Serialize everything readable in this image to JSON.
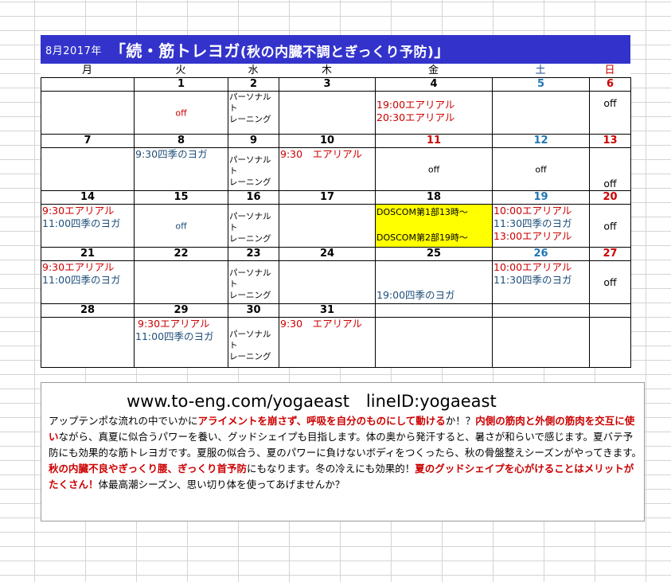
{
  "title": {
    "month": "8月2017年",
    "main_prefix": "「続・筋トレヨガ",
    "main_sub": "(秋の内臓不調とぎっくり予防)",
    "main_suffix": "」"
  },
  "weekdays": [
    "月",
    "火",
    "水",
    "木",
    "金",
    "土",
    "日"
  ],
  "weeks": [
    {
      "nums": [
        "",
        "1",
        "2",
        "3",
        "4",
        "5",
        "6"
      ],
      "cells": [
        {
          "events": []
        },
        {
          "off": "off"
        },
        {
          "personal": [
            "パーソナルト",
            "レーニング"
          ]
        },
        {
          "events": []
        },
        {
          "events": [
            "19:00エアリアル",
            "20:30エアリアル"
          ]
        },
        {
          "events": []
        },
        {
          "off": "off"
        }
      ]
    },
    {
      "nums": [
        "7",
        "8",
        "9",
        "10",
        "11",
        "12",
        "13"
      ],
      "cells": [
        {
          "events": []
        },
        {
          "events": [
            "9:30四季のヨガ"
          ]
        },
        {
          "personal": [
            "パーソナルト",
            "レーニング"
          ]
        },
        {
          "events": [
            "9:30　エアリアル"
          ]
        },
        {
          "off": "off"
        },
        {
          "off": "off"
        },
        {
          "off": "off"
        }
      ]
    },
    {
      "nums": [
        "14",
        "15",
        "16",
        "17",
        "18",
        "19",
        "20"
      ],
      "cells": [
        {
          "events": [
            "9:30エアリアル",
            "11:00四季のヨガ"
          ]
        },
        {
          "off": "off"
        },
        {
          "personal": [
            "パーソナルト",
            "レーニング"
          ]
        },
        {
          "events": []
        },
        {
          "doscom": [
            "DOSCOM第1部13時～",
            "DOSCOM第2部19時～"
          ]
        },
        {
          "events": [
            "10:00エアリアル",
            "11:30四季のヨガ",
            "13:00エアリアル"
          ]
        },
        {
          "off": "off"
        }
      ]
    },
    {
      "nums": [
        "21",
        "22",
        "23",
        "24",
        "25",
        "26",
        "27"
      ],
      "cells": [
        {
          "events": [
            "9:30エアリアル",
            "11:00四季のヨガ"
          ]
        },
        {
          "events": []
        },
        {
          "personal": [
            "パーソナルト",
            "レーニング"
          ]
        },
        {
          "events": []
        },
        {
          "events": [
            "19:00四季のヨガ"
          ]
        },
        {
          "events": [
            "10:00エアリアル",
            "11:30四季のヨガ"
          ]
        },
        {
          "off": "off"
        }
      ]
    },
    {
      "nums": [
        "28",
        "29",
        "30",
        "31",
        "",
        "",
        ""
      ],
      "cells": [
        {
          "events": []
        },
        {
          "events": [
            "9:30エアリアル",
            "11:00四季のヨガ"
          ]
        },
        {
          "personal": [
            "パーソナルト",
            "レーニング"
          ]
        },
        {
          "events": [
            "9:30　エアリアル"
          ]
        },
        {
          "events": []
        },
        {
          "events": []
        },
        {
          "events": []
        }
      ]
    }
  ],
  "info": {
    "url": "www.to-eng.com/yogaeast　lineID:yogaeast",
    "p1": "アップテンポな流れの中でいかに",
    "h1": "アライメントを崩さず、呼吸を自分のものにして動ける",
    "p2": "か！？",
    "h2": "内側の筋肉と外側の筋肉を交互に使い",
    "p3": "ながら、真夏に似合うパワーを養い、グッドシェイプも目指します。体の奥から発汗すると、暑さが和らいで感じます。夏バテ予防にも効果的な筋トレヨガです。夏服の似合う、夏のパワーに負けないボディをつくったら、秋の骨盤整えシーズンがやってきます。",
    "h3": "秋の内臓不良やぎっくり腰、ぎっくり首予防",
    "p4": "にもなります。冬の冷えにも効果的！",
    "h4": "夏のグッドシェイプを心がけることはメリットがたくさん！",
    "p5": "体最高潮シーズン、思い切り体を使ってあげませんか？"
  },
  "colors": {
    "title_bg": "#3333cc",
    "red": "#cc0000",
    "blue_text": "#1f4e79",
    "saturday": "#1f77b4",
    "highlight": "#ffff00"
  }
}
